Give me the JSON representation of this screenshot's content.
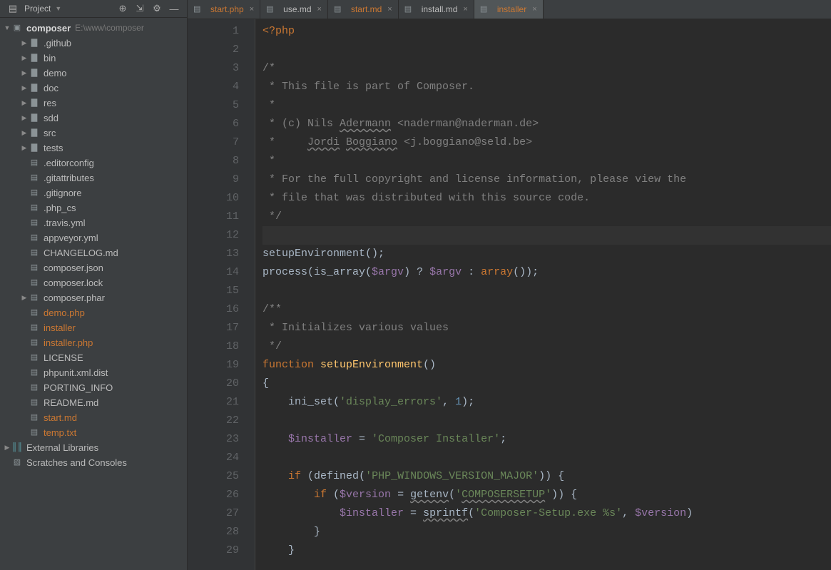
{
  "sidebar": {
    "title": "Project",
    "project_name": "composer",
    "project_path": "E:\\www\\composer",
    "external_libs": "External Libraries",
    "scratches": "Scratches and Consoles",
    "items": [
      {
        "label": ".github",
        "type": "folder",
        "indent": 2,
        "arrow": true
      },
      {
        "label": "bin",
        "type": "folder",
        "indent": 2,
        "arrow": true
      },
      {
        "label": "demo",
        "type": "folder",
        "indent": 2,
        "arrow": true
      },
      {
        "label": "doc",
        "type": "folder",
        "indent": 2,
        "arrow": true
      },
      {
        "label": "res",
        "type": "folder",
        "indent": 2,
        "arrow": true
      },
      {
        "label": "sdd",
        "type": "folder",
        "indent": 2,
        "arrow": true
      },
      {
        "label": "src",
        "type": "folder",
        "indent": 2,
        "arrow": true
      },
      {
        "label": "tests",
        "type": "folder",
        "indent": 2,
        "arrow": true
      },
      {
        "label": ".editorconfig",
        "type": "file",
        "indent": 2
      },
      {
        "label": ".gitattributes",
        "type": "file",
        "indent": 2
      },
      {
        "label": ".gitignore",
        "type": "file",
        "indent": 2
      },
      {
        "label": ".php_cs",
        "type": "file",
        "indent": 2
      },
      {
        "label": ".travis.yml",
        "type": "file",
        "indent": 2
      },
      {
        "label": "appveyor.yml",
        "type": "file",
        "indent": 2
      },
      {
        "label": "CHANGELOG.md",
        "type": "file",
        "indent": 2
      },
      {
        "label": "composer.json",
        "type": "file",
        "indent": 2
      },
      {
        "label": "composer.lock",
        "type": "file",
        "indent": 2
      },
      {
        "label": "composer.phar",
        "type": "file",
        "indent": 2,
        "arrow": true
      },
      {
        "label": "demo.php",
        "type": "file",
        "indent": 2,
        "orange": true
      },
      {
        "label": "installer",
        "type": "file",
        "indent": 2,
        "orange": true
      },
      {
        "label": "installer.php",
        "type": "file",
        "indent": 2,
        "orange": true
      },
      {
        "label": "LICENSE",
        "type": "file",
        "indent": 2
      },
      {
        "label": "phpunit.xml.dist",
        "type": "file",
        "indent": 2
      },
      {
        "label": "PORTING_INFO",
        "type": "file",
        "indent": 2
      },
      {
        "label": "README.md",
        "type": "file",
        "indent": 2
      },
      {
        "label": "start.md",
        "type": "file",
        "indent": 2,
        "orange": true
      },
      {
        "label": "temp.txt",
        "type": "file",
        "indent": 2,
        "orange": true
      }
    ]
  },
  "tabs": [
    {
      "label": "start.php",
      "orange": true,
      "active": false
    },
    {
      "label": "use.md",
      "orange": false,
      "active": false
    },
    {
      "label": "start.md",
      "orange": true,
      "active": false
    },
    {
      "label": "install.md",
      "orange": false,
      "active": false
    },
    {
      "label": "installer",
      "orange": true,
      "active": true
    }
  ],
  "code": {
    "lines": [
      {
        "n": 1,
        "segs": [
          {
            "t": "<?php",
            "c": "c-tag"
          }
        ]
      },
      {
        "n": 2,
        "segs": []
      },
      {
        "n": 3,
        "segs": [
          {
            "t": "/*",
            "c": "c-comment"
          }
        ]
      },
      {
        "n": 4,
        "segs": [
          {
            "t": " * This file is part of Composer.",
            "c": "c-comment"
          }
        ]
      },
      {
        "n": 5,
        "segs": [
          {
            "t": " *",
            "c": "c-comment"
          }
        ]
      },
      {
        "n": 6,
        "segs": [
          {
            "t": " * (c) Nils ",
            "c": "c-comment"
          },
          {
            "t": "Adermann",
            "c": "c-comment c-underl"
          },
          {
            "t": " <naderman@naderman.de>",
            "c": "c-comment"
          }
        ]
      },
      {
        "n": 7,
        "segs": [
          {
            "t": " *     ",
            "c": "c-comment"
          },
          {
            "t": "Jordi",
            "c": "c-comment c-underl"
          },
          {
            "t": " ",
            "c": "c-comment"
          },
          {
            "t": "Boggiano",
            "c": "c-comment c-underl"
          },
          {
            "t": " <j.boggiano@seld.be>",
            "c": "c-comment"
          }
        ]
      },
      {
        "n": 8,
        "segs": [
          {
            "t": " *",
            "c": "c-comment"
          }
        ]
      },
      {
        "n": 9,
        "segs": [
          {
            "t": " * For the full copyright and license information, please view the",
            "c": "c-comment"
          }
        ]
      },
      {
        "n": 10,
        "segs": [
          {
            "t": " * file that was distributed with this source code.",
            "c": "c-comment"
          }
        ]
      },
      {
        "n": 11,
        "segs": [
          {
            "t": " */",
            "c": "c-comment"
          }
        ]
      },
      {
        "n": 12,
        "segs": [],
        "hl": true
      },
      {
        "n": 13,
        "segs": [
          {
            "t": "setupEnvironment();",
            "c": "c-ident"
          }
        ]
      },
      {
        "n": 14,
        "segs": [
          {
            "t": "process(",
            "c": "c-ident"
          },
          {
            "t": "is_array",
            "c": "c-ident"
          },
          {
            "t": "(",
            "c": "c-ident"
          },
          {
            "t": "$argv",
            "c": "c-var"
          },
          {
            "t": ") ? ",
            "c": "c-ident"
          },
          {
            "t": "$argv",
            "c": "c-var"
          },
          {
            "t": " : ",
            "c": "c-ident"
          },
          {
            "t": "array",
            "c": "c-keyword"
          },
          {
            "t": "());",
            "c": "c-ident"
          }
        ]
      },
      {
        "n": 15,
        "segs": []
      },
      {
        "n": 16,
        "segs": [
          {
            "t": "/**",
            "c": "c-comment"
          }
        ]
      },
      {
        "n": 17,
        "segs": [
          {
            "t": " * Initializes various values",
            "c": "c-comment"
          }
        ]
      },
      {
        "n": 18,
        "segs": [
          {
            "t": " */",
            "c": "c-comment"
          }
        ]
      },
      {
        "n": 19,
        "segs": [
          {
            "t": "function ",
            "c": "c-keyword"
          },
          {
            "t": "setupEnvironment",
            "c": "c-func"
          },
          {
            "t": "()",
            "c": "c-ident"
          }
        ]
      },
      {
        "n": 20,
        "segs": [
          {
            "t": "{",
            "c": "c-ident"
          }
        ]
      },
      {
        "n": 21,
        "segs": [
          {
            "t": "    ini_set(",
            "c": "c-ident"
          },
          {
            "t": "'display_errors'",
            "c": "c-string"
          },
          {
            "t": ", ",
            "c": "c-ident"
          },
          {
            "t": "1",
            "c": "c-number"
          },
          {
            "t": ");",
            "c": "c-ident"
          }
        ]
      },
      {
        "n": 22,
        "segs": []
      },
      {
        "n": 23,
        "segs": [
          {
            "t": "    ",
            "c": ""
          },
          {
            "t": "$installer",
            "c": "c-var"
          },
          {
            "t": " = ",
            "c": "c-ident"
          },
          {
            "t": "'Composer Installer'",
            "c": "c-string"
          },
          {
            "t": ";",
            "c": "c-ident"
          }
        ]
      },
      {
        "n": 24,
        "segs": []
      },
      {
        "n": 25,
        "segs": [
          {
            "t": "    ",
            "c": ""
          },
          {
            "t": "if ",
            "c": "c-keyword"
          },
          {
            "t": "(",
            "c": "c-ident"
          },
          {
            "t": "defined",
            "c": "c-ident"
          },
          {
            "t": "(",
            "c": "c-ident"
          },
          {
            "t": "'PHP_WINDOWS_VERSION_MAJOR'",
            "c": "c-string"
          },
          {
            "t": ")) {",
            "c": "c-ident"
          }
        ]
      },
      {
        "n": 26,
        "segs": [
          {
            "t": "        ",
            "c": ""
          },
          {
            "t": "if ",
            "c": "c-keyword"
          },
          {
            "t": "(",
            "c": "c-ident"
          },
          {
            "t": "$version",
            "c": "c-var"
          },
          {
            "t": " = ",
            "c": "c-ident"
          },
          {
            "t": "getenv",
            "c": "c-ident c-underl"
          },
          {
            "t": "(",
            "c": "c-ident"
          },
          {
            "t": "'",
            "c": "c-string"
          },
          {
            "t": "COMPOSERSETUP",
            "c": "c-string c-underl"
          },
          {
            "t": "'",
            "c": "c-string"
          },
          {
            "t": ")) {",
            "c": "c-ident"
          }
        ]
      },
      {
        "n": 27,
        "segs": [
          {
            "t": "            ",
            "c": ""
          },
          {
            "t": "$installer",
            "c": "c-var"
          },
          {
            "t": " = ",
            "c": "c-ident"
          },
          {
            "t": "sprintf",
            "c": "c-ident c-underl"
          },
          {
            "t": "(",
            "c": "c-ident"
          },
          {
            "t": "'Composer-Setup.exe %s'",
            "c": "c-string"
          },
          {
            "t": ", ",
            "c": "c-ident"
          },
          {
            "t": "$version",
            "c": "c-var"
          },
          {
            "t": ")",
            "c": "c-ident"
          }
        ]
      },
      {
        "n": 28,
        "segs": [
          {
            "t": "        }",
            "c": "c-ident"
          }
        ]
      },
      {
        "n": 29,
        "segs": [
          {
            "t": "    }",
            "c": "c-ident"
          }
        ]
      }
    ]
  }
}
